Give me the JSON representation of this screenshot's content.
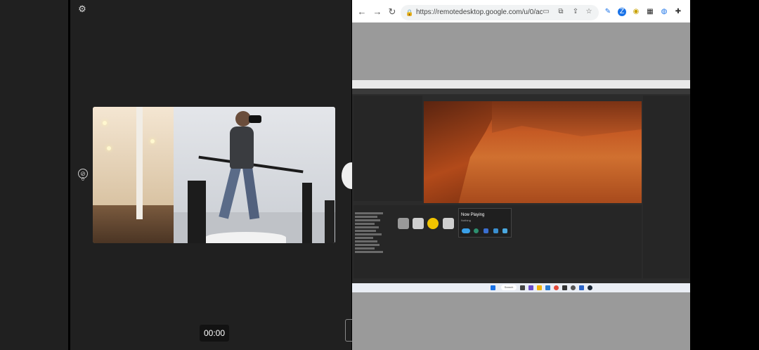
{
  "left_panel": {
    "settings_icon": "gear-icon",
    "side_icon": "disabled-icon",
    "side_count": "0",
    "timer": "00:00"
  },
  "browser": {
    "url": "https://remotedesktop.google.com/u/0/ac...",
    "icons": [
      "back-arrow-icon",
      "forward-arrow-icon",
      "reload-icon",
      "lock-icon",
      "tab-icon",
      "screenshot-icon",
      "share-icon",
      "star-icon",
      "pen-icon",
      "extension-z-icon",
      "extension-circle-icon",
      "apps-grid-icon",
      "extension-user-icon",
      "puzzle-icon"
    ]
  },
  "remote_desktop": {
    "now_playing": {
      "title": "Now Playing",
      "subtitle": "Nothing"
    },
    "taskbar": {
      "search": "Search"
    }
  },
  "colors": {
    "left_bg": "#202020",
    "right_bg": "#9a9a9a",
    "chrome_bar": "#ffffff",
    "mars_orange": "#c55a24"
  }
}
